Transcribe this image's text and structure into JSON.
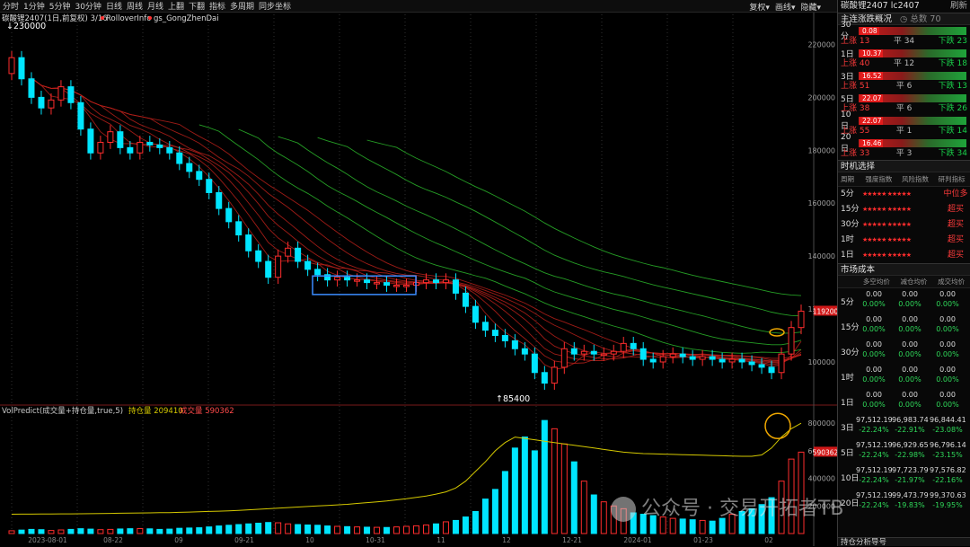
{
  "toolbar": {
    "periods": [
      "分时",
      "1分钟",
      "5分钟",
      "30分钟",
      "日线",
      "周线",
      "月线",
      "上翻",
      "下翻",
      "指标",
      "多周期",
      "同步坐标"
    ],
    "right": [
      "复权",
      "画线",
      "隐藏"
    ]
  },
  "chart": {
    "legend_main": [
      "碳酸锂2407(1日,前复权) 3/16",
      "RolloverInfo",
      "gs_GongZhenDai"
    ],
    "max_label": "230000",
    "min_label": "85400",
    "last_price_tag": "119200",
    "sub_legend": {
      "name": "VolPredict(成交量+持仓量,true,5)",
      "oi_label": "持仓量",
      "oi_value": "209410",
      "vol_label": "成交量",
      "vol_value": "590362"
    },
    "vol_tag": "590362",
    "date_labels": [
      "2023-08-01",
      "08-22",
      "09",
      "09-21",
      "10",
      "10-31",
      "11",
      "12",
      "12-21",
      "2024-01",
      "01-23",
      "02"
    ],
    "watermark": "公众号 · 交易开拓者TB"
  },
  "colors": {
    "up": "#ff2d2d",
    "down": "#00e5ff",
    "oi": "#d4c800",
    "ribbon_red": "#b8201a",
    "ribbon_green": "#2bb82b",
    "box": "#3a8cff",
    "circle": "#f0a800"
  },
  "chart_data": {
    "type": "candlestick",
    "symbol": "碳酸锂2407",
    "ylim": [
      85400,
      230000
    ],
    "yticks": [
      100000,
      120000,
      140000,
      160000,
      180000,
      200000,
      220000
    ],
    "vol_yticks": [
      200000,
      400000,
      600000,
      800000
    ],
    "close": [
      215000,
      207000,
      200000,
      196000,
      199000,
      204000,
      198000,
      188000,
      179000,
      183000,
      187000,
      181000,
      179000,
      183000,
      182000,
      181000,
      179000,
      175000,
      172000,
      169000,
      164000,
      158000,
      153000,
      148000,
      142000,
      138000,
      132000,
      140000,
      143000,
      138000,
      135000,
      133000,
      131000,
      132000,
      131000,
      131000,
      130000,
      130000,
      129000,
      129000,
      129000,
      130000,
      131000,
      130000,
      131000,
      126000,
      121000,
      115000,
      112000,
      110000,
      108000,
      105000,
      103000,
      96000,
      92000,
      98000,
      105000,
      103000,
      104000,
      103000,
      103000,
      104000,
      107000,
      105000,
      101000,
      100000,
      102000,
      103000,
      102000,
      101000,
      102000,
      101000,
      100000,
      101000,
      100000,
      99000,
      98000,
      96000,
      103000,
      113000,
      119200
    ],
    "volume": [
      20000,
      25000,
      30000,
      28000,
      22000,
      26000,
      30000,
      35000,
      32000,
      28000,
      30000,
      33000,
      35000,
      36000,
      34000,
      30000,
      32000,
      38000,
      40000,
      42000,
      48000,
      55000,
      60000,
      65000,
      70000,
      75000,
      80000,
      78000,
      70000,
      65000,
      62000,
      60000,
      55000,
      52000,
      50000,
      48000,
      46000,
      45000,
      44000,
      48000,
      52000,
      56000,
      62000,
      70000,
      85000,
      95000,
      120000,
      160000,
      250000,
      320000,
      450000,
      620000,
      700000,
      600000,
      820000,
      760000,
      650000,
      520000,
      380000,
      280000,
      230000,
      200000,
      180000,
      150000,
      140000,
      130000,
      120000,
      110000,
      105000,
      100000,
      95000,
      90000,
      110000,
      140000,
      160000,
      180000,
      210000,
      260000,
      380000,
      540000,
      590362
    ],
    "open_interest": [
      140000,
      140500,
      141000,
      141500,
      142000,
      142500,
      143000,
      143500,
      144000,
      145000,
      146000,
      147000,
      148000,
      149000,
      150000,
      151000,
      152000,
      154000,
      156000,
      158000,
      160000,
      162000,
      165000,
      168000,
      172000,
      176000,
      180000,
      184000,
      188000,
      192000,
      196000,
      200000,
      204000,
      208000,
      212000,
      218000,
      224000,
      230000,
      236000,
      244000,
      252000,
      262000,
      272000,
      286000,
      302000,
      330000,
      380000,
      450000,
      520000,
      600000,
      660000,
      700000,
      690000,
      680000,
      670000,
      660000,
      650000,
      640000,
      630000,
      620000,
      610000,
      600000,
      590000,
      585000,
      580000,
      578000,
      576000,
      574000,
      572000,
      570000,
      568000,
      566000,
      564000,
      562000,
      560000,
      560000,
      570000,
      620000,
      700000,
      760000,
      800000
    ]
  },
  "panel": {
    "symbol": "碳酸锂2407",
    "code": "lc2407",
    "refresh": "刷新",
    "adv_title": "主连涨跌概况",
    "adv_count_label": "总数",
    "adv_count": "70",
    "adv_rows": [
      {
        "up": "",
        "flat": "",
        "down": "",
        "period": "30分",
        "val": "0.08"
      },
      {
        "up": "上涨 13",
        "flat": "平 34",
        "down": "下跌 23",
        "period": "1日",
        "val": "10.37"
      },
      {
        "up": "上涨 40",
        "flat": "平 12",
        "down": "下跌 18",
        "period": "3日",
        "val": "16.52"
      },
      {
        "up": "上涨 51",
        "flat": "平 6",
        "down": "下跌 13",
        "period": "5日",
        "val": "22.07"
      },
      {
        "up": "上涨 38",
        "flat": "平 6",
        "down": "下跌 26",
        "period": "10日",
        "val": "22.07"
      },
      {
        "up": "上涨 55",
        "flat": "平 1",
        "down": "下跌 14",
        "period": "20日",
        "val": "16.46"
      },
      {
        "up": "上涨 33",
        "flat": "平 3",
        "down": "下跌 34",
        "period": "",
        "val": ""
      }
    ],
    "timing_title": "时机选择",
    "timing_header": [
      "周期",
      "强度指数",
      "风险指数",
      "研判指标"
    ],
    "timing_rows": [
      {
        "period": "5分",
        "s1": "★★★★★",
        "s2": "★★★★★",
        "sig": "中位多"
      },
      {
        "period": "15分",
        "s1": "★★★★★",
        "s2": "★★★★★",
        "sig": "超买"
      },
      {
        "period": "30分",
        "s1": "★★★★★",
        "s2": "★★★★★",
        "sig": "超买"
      },
      {
        "period": "1时",
        "s1": "★★★★★",
        "s2": "★★★★★",
        "sig": "超买"
      },
      {
        "period": "1日",
        "s1": "★★★★★",
        "s2": "★★★★★",
        "sig": "超买"
      }
    ],
    "cost_title": "市场成本",
    "cost_header": [
      "周期",
      "多空均价",
      "减仓均价",
      "成交均价"
    ],
    "cost_rows": [
      {
        "period": "5分",
        "a1": "0.00",
        "b1": "0.00%",
        "a2": "0.00",
        "b2": "0.00%",
        "a3": "0.00",
        "b3": "0.00%"
      },
      {
        "period": "15分",
        "a1": "0.00",
        "b1": "0.00%",
        "a2": "0.00",
        "b2": "0.00%",
        "a3": "0.00",
        "b3": "0.00%"
      },
      {
        "period": "30分",
        "a1": "0.00",
        "b1": "0.00%",
        "a2": "0.00",
        "b2": "0.00%",
        "a3": "0.00",
        "b3": "0.00%"
      },
      {
        "period": "1时",
        "a1": "0.00",
        "b1": "0.00%",
        "a2": "0.00",
        "b2": "0.00%",
        "a3": "0.00",
        "b3": "0.00%"
      },
      {
        "period": "1日",
        "a1": "0.00",
        "b1": "0.00%",
        "a2": "0.00",
        "b2": "0.00%",
        "a3": "0.00",
        "b3": "0.00%"
      },
      {
        "period": "3日",
        "a1": "97,512.19",
        "b1": "-22.24%",
        "a2": "96,983.74",
        "b2": "-22.91%",
        "a3": "96,844.41",
        "b3": "-23.08%"
      },
      {
        "period": "5日",
        "a1": "97,512.19",
        "b1": "-22.24%",
        "a2": "96,929.65",
        "b2": "-22.98%",
        "a3": "96,796.14",
        "b3": "-23.15%"
      },
      {
        "period": "10日",
        "a1": "97,512.19",
        "b1": "-22.24%",
        "a2": "97,723.79",
        "b2": "-21.97%",
        "a3": "97,576.82",
        "b3": "-22.16%"
      },
      {
        "period": "20日",
        "a1": "97,512.19",
        "b1": "-22.24%",
        "a2": "99,473.79",
        "b2": "-19.83%",
        "a3": "99,370.63",
        "b3": "-19.95%"
      }
    ],
    "footer": "持仓分析导号"
  }
}
